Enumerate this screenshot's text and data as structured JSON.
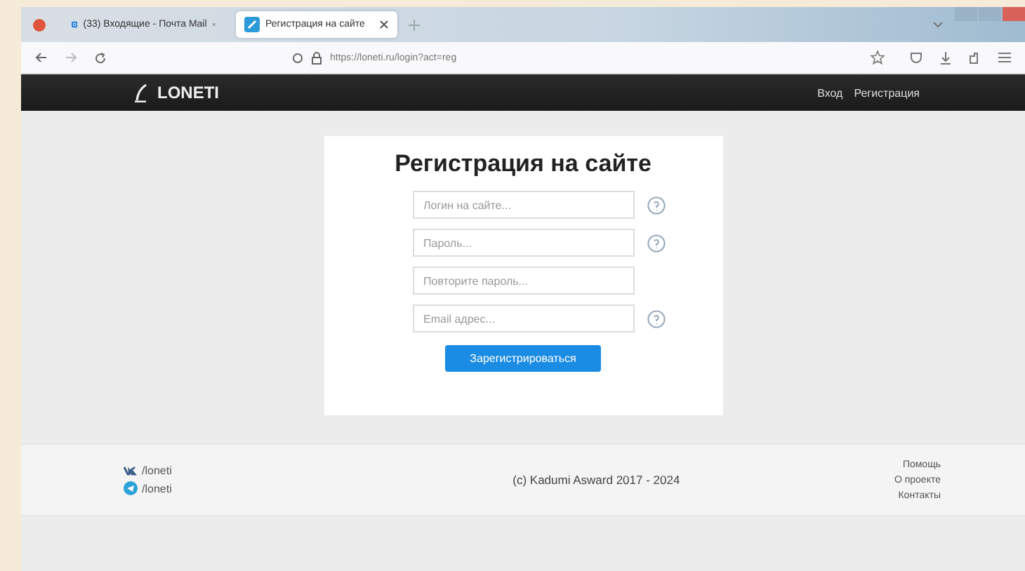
{
  "browser": {
    "tabs": [
      {
        "title": "(33) Входящие - Почта Mail",
        "kind": "mail",
        "selected": false
      },
      {
        "title": "Регистрация на сайте",
        "kind": "site",
        "selected": true
      }
    ],
    "url": "https://loneti.ru/login?act=reg"
  },
  "site_header": {
    "logo": "LONETI",
    "nav": [
      {
        "label": "Вход"
      },
      {
        "label": "Регистрация"
      }
    ]
  },
  "form": {
    "title": "Регистрация на сайте",
    "fields": [
      {
        "placeholder": "Логин на сайте...",
        "help": true
      },
      {
        "placeholder": "Пароль...",
        "help": true
      },
      {
        "placeholder": "Повторите пароль...",
        "help": false
      },
      {
        "placeholder": "Email адрес...",
        "help": true
      }
    ],
    "submit": "Зарегистрироваться"
  },
  "footer": {
    "social": [
      {
        "kind": "vk",
        "label": "/loneti"
      },
      {
        "kind": "telegram",
        "label": "/loneti"
      }
    ],
    "copyright": "(c) Kadumi Asward 2017 - 2024",
    "links": [
      "Помощь",
      "О проекте",
      "Контакты"
    ]
  }
}
